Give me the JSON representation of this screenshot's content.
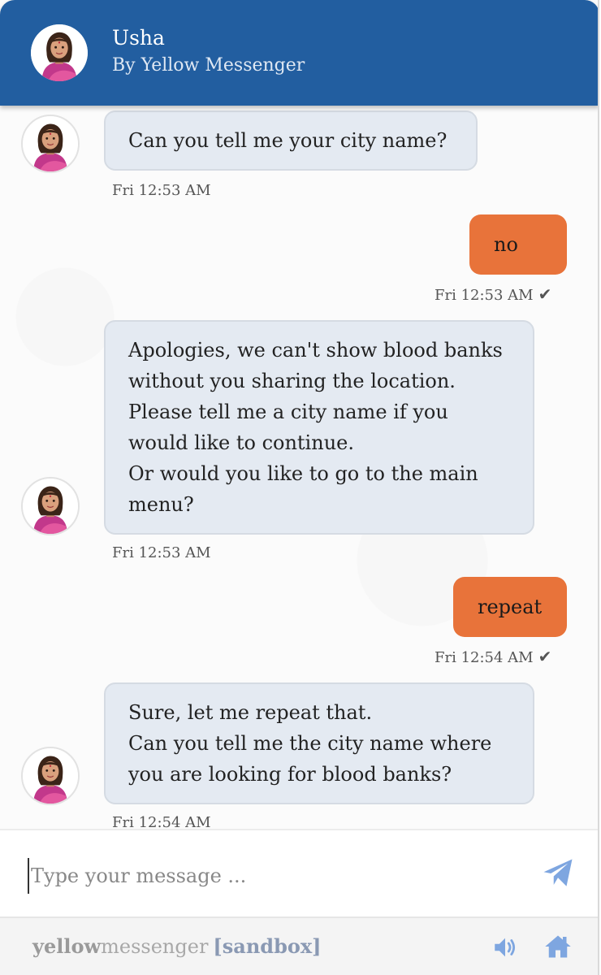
{
  "header": {
    "title": "Usha",
    "subtitle": "By Yellow Messenger"
  },
  "messages": [
    {
      "sender": "bot",
      "text": "Can you tell me your city name?",
      "time": "Fri 12:53 AM"
    },
    {
      "sender": "user",
      "text": "no",
      "time": "Fri 12:53 AM"
    },
    {
      "sender": "bot",
      "lines": [
        "Apologies, we can't show blood banks",
        "without you sharing the location.",
        "Please tell me a city name if you",
        "would like to continue.",
        "Or would you like to go to the main",
        "menu?"
      ],
      "time": "Fri 12:53 AM"
    },
    {
      "sender": "user",
      "text": "repeat",
      "time": "Fri 12:54 AM"
    },
    {
      "sender": "bot",
      "lines": [
        "Sure, let me repeat that.",
        "Can you tell me the city name where",
        "you are looking for blood banks?"
      ],
      "time": "Fri 12:54 AM"
    }
  ],
  "composer": {
    "placeholder": "Type your message ...",
    "send_icon": "send-icon"
  },
  "footer": {
    "brand_part1": "yellow",
    "brand_part2": "messenger",
    "brand_part3": "[sandbox]",
    "speaker_icon": "speaker-icon",
    "home_icon": "home-icon"
  },
  "colors": {
    "header": "#225ea0",
    "user_bubble": "#e8733a",
    "bot_bubble": "#e4eaf2",
    "icon_blue": "#7ea6e0"
  }
}
